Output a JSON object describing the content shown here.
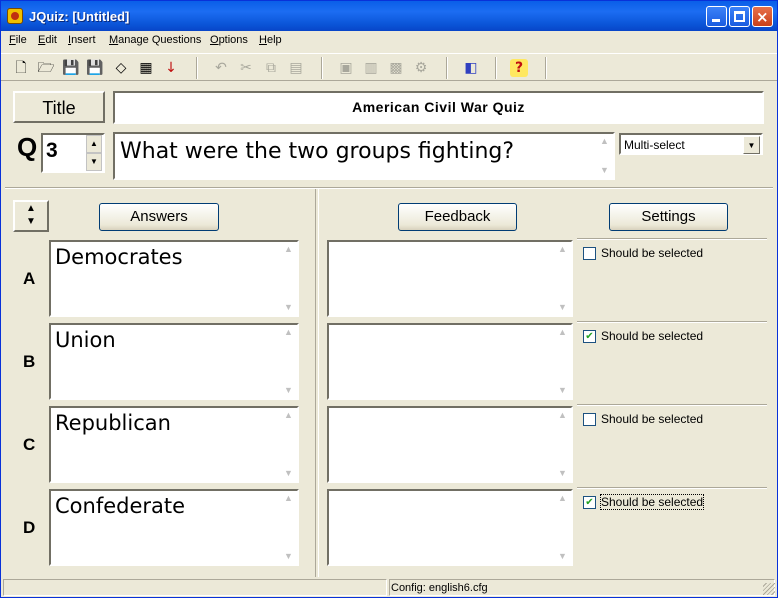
{
  "window": {
    "title": "JQuiz: [Untitled]"
  },
  "menu": [
    "File",
    "Edit",
    "Insert",
    "Manage Questions",
    "Options",
    "Help"
  ],
  "toolbar": {
    "groups": [
      [
        "new-file-icon",
        "open-folder-icon",
        "save-icon",
        "save-as-icon",
        "eraser-icon",
        "web-page-icon",
        "export-arrow-icon"
      ],
      [
        "undo-icon",
        "cut-icon",
        "copy-icon",
        "paste-icon"
      ],
      [
        "add-question-icon",
        "stack-icon",
        "grid-icon",
        "settings-icon"
      ],
      [
        "config-icon"
      ],
      [
        "help-icon"
      ]
    ]
  },
  "quiz": {
    "title_button": "Title",
    "title": "American Civil War Quiz"
  },
  "question": {
    "label": "Q",
    "number": "3",
    "text": "What were the two groups fighting?",
    "type": "Multi-select"
  },
  "headers": {
    "answers": "Answers",
    "feedback": "Feedback",
    "settings": "Settings"
  },
  "answers": [
    {
      "letter": "A",
      "text": "Democrates",
      "feedback": "",
      "should_be_selected": false,
      "setting_label": "Should be selected"
    },
    {
      "letter": "B",
      "text": "Union",
      "feedback": "",
      "should_be_selected": true,
      "setting_label": "Should be selected"
    },
    {
      "letter": "C",
      "text": "Republican",
      "feedback": "",
      "should_be_selected": false,
      "setting_label": "Should be selected"
    },
    {
      "letter": "D",
      "text": "Confederate",
      "feedback": "",
      "should_be_selected": true,
      "setting_label": "Should be selected"
    }
  ],
  "status": {
    "config": "Config: english6.cfg"
  }
}
